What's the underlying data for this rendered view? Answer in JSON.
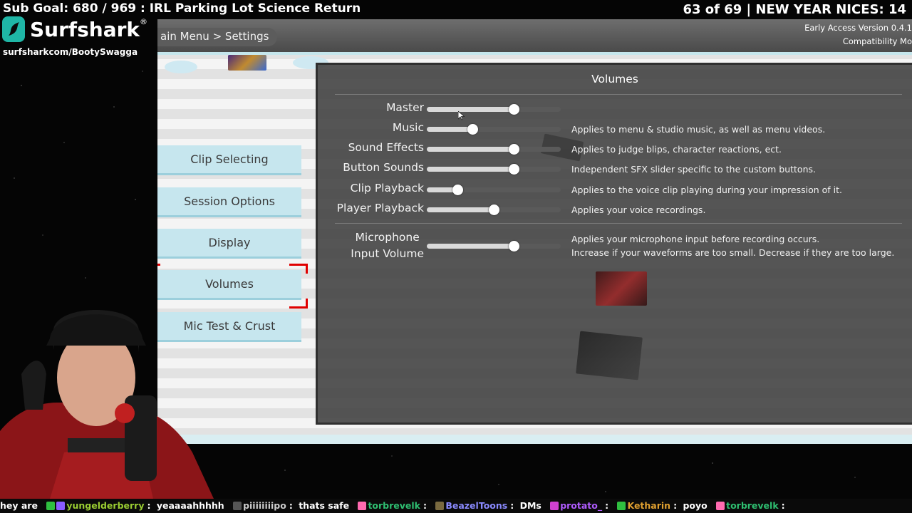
{
  "overlay": {
    "sub_goal": "Sub Goal: 680 / 969 : IRL Parking Lot Science Return",
    "counter": "63 of 69 | NEW YEAR NICES: 14",
    "sponsor_name": "Surfshark",
    "sponsor_mark": "®",
    "sponsor_url": "surfsharkcom/BootySwagga"
  },
  "game": {
    "breadcrumb": "ain Menu > Settings",
    "version_line1": "Early Access Version 0.4.1",
    "version_line2": "Compatibility Mo",
    "menu": [
      {
        "label": "Clip Selecting"
      },
      {
        "label": "Session Options"
      },
      {
        "label": "Display"
      },
      {
        "label": "Volumes"
      },
      {
        "label": "Mic Test & Crust"
      }
    ],
    "selected": "Volumes"
  },
  "volumes": {
    "title": "Volumes",
    "rows": [
      {
        "label": "Master",
        "value": 0.65,
        "desc": ""
      },
      {
        "label": "Music",
        "value": 0.34,
        "desc": "Applies to menu & studio music, as well as menu videos."
      },
      {
        "label": "Sound Effects",
        "value": 0.65,
        "desc": "Applies to judge blips, character reactions, ect."
      },
      {
        "label": "Button Sounds",
        "value": 0.65,
        "desc": "Independent SFX slider specific to the custom buttons."
      },
      {
        "label": "Clip Playback",
        "value": 0.23,
        "desc": "Applies to the voice clip playing during your impression of it."
      },
      {
        "label": "Player Playback",
        "value": 0.5,
        "desc": "Applies your voice recordings."
      }
    ],
    "mic": {
      "label_line1": "Microphone",
      "label_line2": "Input Volume",
      "value": 0.65,
      "desc_line1": "Applies your microphone input before recording occurs.",
      "desc_line2": "Increase if your waveforms are too small. Decrease if they are too large."
    }
  },
  "chat": [
    {
      "user": "",
      "text": "hey are",
      "color": "#ffffff"
    },
    {
      "user": "yungelderberry",
      "text": "yeaaaahhhhh",
      "color": "#9acd32"
    },
    {
      "user": "piiiiiiiipo",
      "text": "thats safe",
      "color": "#cccccc"
    },
    {
      "user": "torbrevelk",
      "text": "",
      "color": "#2fbf71"
    },
    {
      "user": "BeazelToons",
      "text": "DMs",
      "color": "#8a8aff"
    },
    {
      "user": "protato_",
      "text": "",
      "color": "#b05cff"
    },
    {
      "user": "Ketharin",
      "text": "poyo",
      "color": "#e0a030"
    },
    {
      "user": "torbrevelk",
      "text": "",
      "color": "#2fbf71"
    }
  ]
}
